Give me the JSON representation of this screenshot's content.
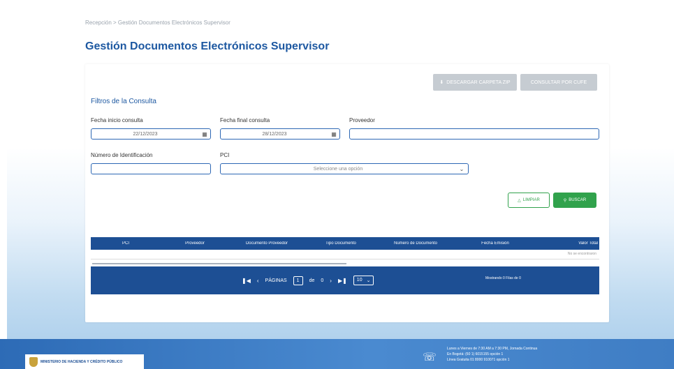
{
  "breadcrumb": "Recepción > Gestión Documentos Electrónicos Supervisor",
  "page_title": "Gestión Documentos Electrónicos Supervisor",
  "actions": {
    "download": "DESCARGAR CARPETA ZIP",
    "consult": "CONSULTAR POR CUFE"
  },
  "filters": {
    "title": "Filtros de la Consulta",
    "start_label": "Fecha inicio consulta",
    "start_value": "22/12/2023",
    "end_label": "Fecha final consulta",
    "end_value": "28/12/2023",
    "provider_label": "Proveedor",
    "provider_value": "",
    "id_label": "Número de Identificación",
    "id_value": "",
    "pci_label": "PCI",
    "pci_placeholder": "Seleccione una opción"
  },
  "buttons": {
    "clear": "LIMPIAR",
    "search": "BUSCAR"
  },
  "table": {
    "columns": [
      "PCI",
      "Proveedor",
      "Documento Proveedor",
      "Tipo Documento",
      "Número de Documento",
      "Fecha Emisión",
      "Valor Total"
    ],
    "empty_text": "No se encontraron"
  },
  "pager": {
    "pages_label": "PÁGINAS",
    "current_page": "1",
    "of_label": "de",
    "total_pages": "0",
    "page_size": "10",
    "info": "Mostrando 0 Filas de 0"
  },
  "footer": {
    "ministry": "MINISTERIO DE HACIENDA Y CRÉDITO PÚBLICO",
    "line1": "Lunes a Viernes de 7:30 AM a 7:30 PM, Jornada Continua",
    "line2": "En Bogotá: (60 1) 6015155 opción 1",
    "line3": "Línea Gratuita 01 8000 910071 opción 1"
  }
}
